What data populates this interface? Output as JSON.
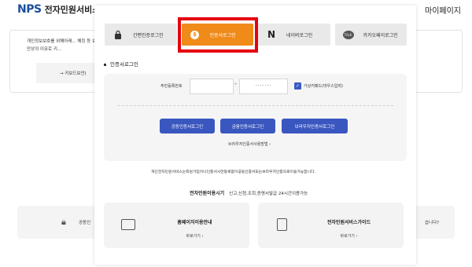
{
  "header": {
    "logo_mark": "NPS",
    "logo_text": "전자민원서비스",
    "mypage": "마이페이지"
  },
  "background": {
    "notice": "개인정보보호를 위해아래... 해킹 등 보안상의 이유로 키...",
    "keyboard_button": "→ 키보드보안(",
    "gong_label": "공동인",
    "right_label": "습니다?"
  },
  "modal": {
    "tabs": [
      {
        "label": "간편인증로그인",
        "icon": "lock-icon"
      },
      {
        "label": "인증서로그인",
        "icon": "certificate-icon"
      },
      {
        "label": "네이버로그인",
        "icon": "naver-icon"
      },
      {
        "label": "카카오페이로그인",
        "icon": "kakao-icon"
      }
    ],
    "naver_glyph": "N",
    "kakao_glyph": "TALK",
    "cert_glyph": "$",
    "section_title": "인증서로그인",
    "rrn_label": "주민등록번호",
    "rrn_back_value": "·······",
    "virtual_keyboard_label": "가상키패드(마우스입력)",
    "cert_buttons": [
      "공동인증서로그인",
      "금융인증서로그인",
      "브라우저인증서로그인"
    ],
    "guide_link": "브라우저인증서사용방법  ›",
    "notice": "개인전자민원서비스는회원가입이나인증서사전등록없이공동인증서또는브라우저인증으로이용가능합니다.",
    "hours_title": "전자민원이용시기",
    "hours_text": "신고,신청,조회,증명서발급 24시간이용가능",
    "cards": [
      {
        "title": "홈페이지이용안내",
        "link": "바로가기  ›",
        "icon": "monitor-icon"
      },
      {
        "title": "전자민원서비스가이드",
        "link": "바로가기  ›",
        "icon": "document-icon"
      }
    ]
  },
  "colors": {
    "active_tab": "#f08a18",
    "button_blue": "#3a57c0",
    "highlight": "#e5000f"
  }
}
